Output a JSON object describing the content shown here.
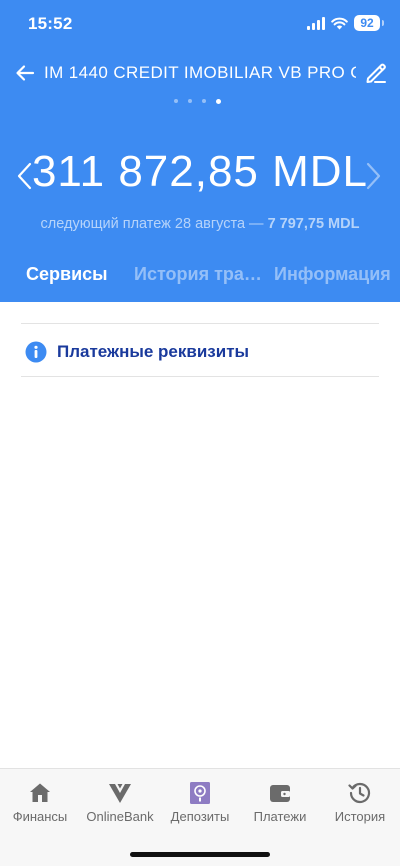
{
  "status_bar": {
    "time": "15:52",
    "battery": "92"
  },
  "header": {
    "account_title": "IM 1440 CREDIT IMOBILIAR VB PRO C...",
    "balance": "311 872,85 MDL",
    "next_payment_prefix": "следующий платеж 28 августа — ",
    "next_payment_amount": "7 797,75 MDL",
    "page_dots": {
      "count": 4,
      "active_index": 3
    }
  },
  "tabs": [
    {
      "label": "Сервисы",
      "active": true
    },
    {
      "label": "История транзакций",
      "active": false
    },
    {
      "label": "Информация",
      "active": false
    }
  ],
  "services": {
    "items": [
      {
        "label": "Платежные реквизиты",
        "icon": "info-icon"
      }
    ]
  },
  "bottom_nav": {
    "items": [
      {
        "label": "Финансы",
        "icon": "home-icon"
      },
      {
        "label": "OnlineBank",
        "icon": "onlinebank-logo-icon"
      },
      {
        "label": "Депозиты",
        "icon": "safe-icon"
      },
      {
        "label": "Платежи",
        "icon": "wallet-icon"
      },
      {
        "label": "История",
        "icon": "history-clock-icon"
      }
    ]
  },
  "colors": {
    "brand_blue": "#3d8bf2",
    "link_navy": "#1a3a9c",
    "deposit_purple": "#8e7cc3"
  }
}
